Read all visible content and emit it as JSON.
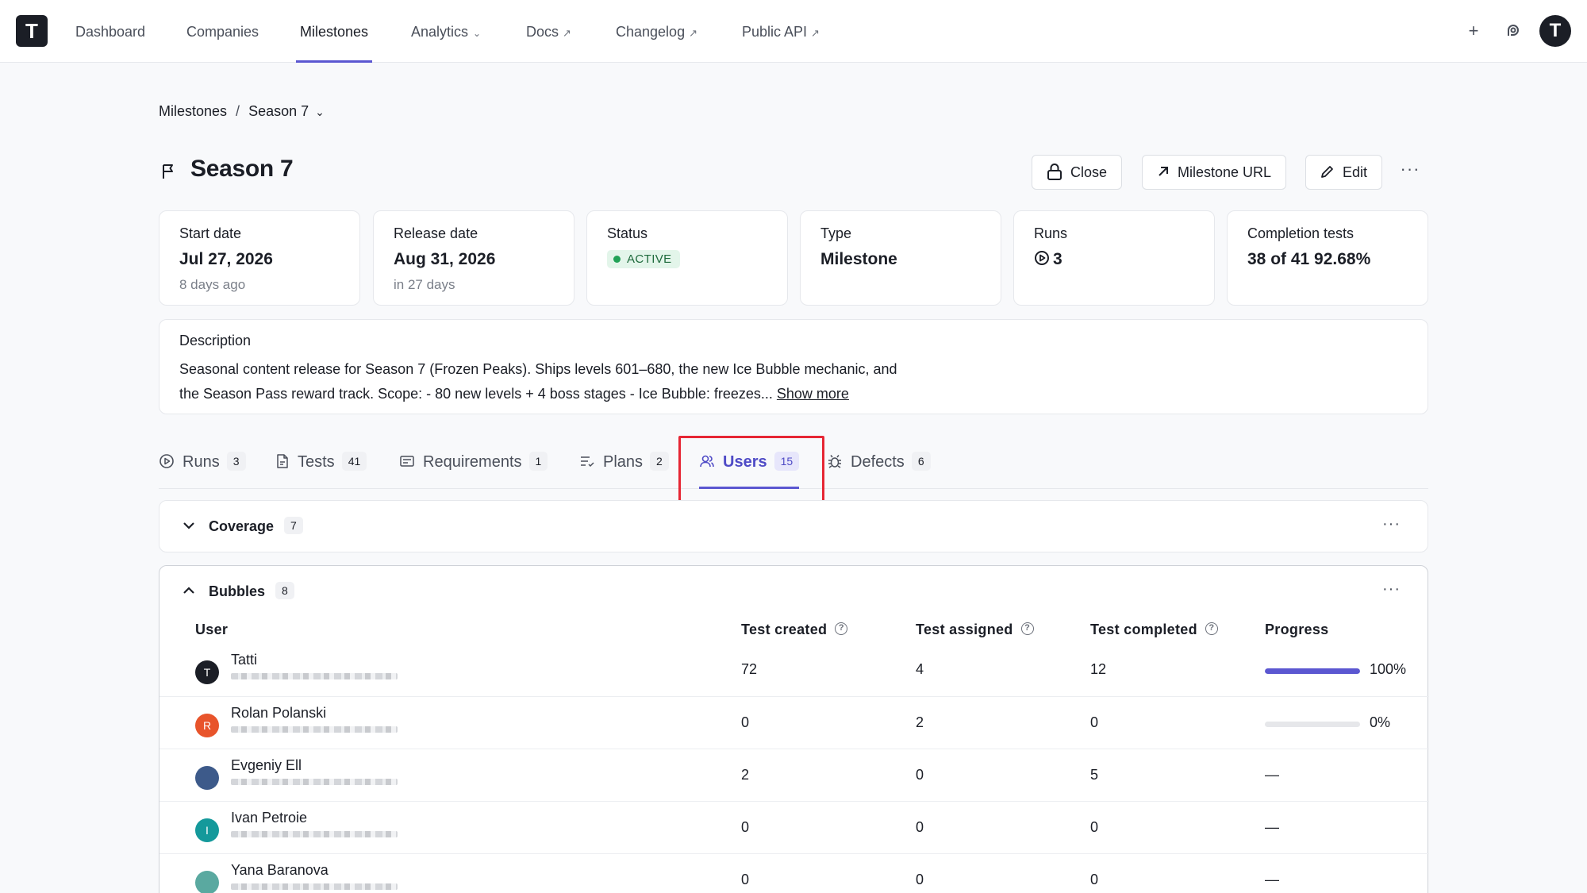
{
  "nav": {
    "logo": "T",
    "items": [
      {
        "label": "Dashboard"
      },
      {
        "label": "Companies"
      },
      {
        "label": "Milestones"
      },
      {
        "label": "Analytics"
      },
      {
        "label": "Docs"
      },
      {
        "label": "Changelog"
      },
      {
        "label": "Public API"
      }
    ],
    "active": "Milestones",
    "avatar": "T"
  },
  "breadcrumb": {
    "root": "Milestones",
    "separator": "/",
    "current": "Season 7"
  },
  "page": {
    "title": "Season 7"
  },
  "actions": {
    "close": "Close",
    "url": "Milestone URL",
    "edit": "Edit",
    "more": "···"
  },
  "stats": {
    "start": {
      "label": "Start date",
      "value": "Jul 27, 2026",
      "sub": "8 days ago"
    },
    "release": {
      "label": "Release date",
      "value": "Aug 31, 2026",
      "sub": "in 27 days"
    },
    "status": {
      "label": "Status",
      "value": "ACTIVE"
    },
    "type": {
      "label": "Type",
      "value": "Milestone"
    },
    "runs": {
      "label": "Runs",
      "value": "3"
    },
    "completion": {
      "label": "Completion tests",
      "value": "38 of 41 92.68%"
    }
  },
  "description": {
    "label": "Description",
    "line1": "Seasonal content release for Season 7 (Frozen Peaks). Ships levels 601–680, the new Ice Bubble mechanic, and",
    "line2": "the Season Pass reward track. Scope: - 80 new levels + 4 boss stages - Ice Bubble: freezes... ",
    "show_more": "Show more"
  },
  "tabs": [
    {
      "label": "Runs",
      "count": "3"
    },
    {
      "label": "Tests",
      "count": "41"
    },
    {
      "label": "Requirements",
      "count": "1"
    },
    {
      "label": "Plans",
      "count": "2"
    },
    {
      "label": "Users",
      "count": "15"
    },
    {
      "label": "Defects",
      "count": "6"
    }
  ],
  "groups": {
    "coverage": {
      "name": "Coverage",
      "count": "7",
      "more": "···"
    },
    "bubbles": {
      "name": "Bubbles",
      "count": "8",
      "more": "···",
      "columns": {
        "user": "User",
        "created": "Test created",
        "assigned": "Test assigned",
        "completed": "Test completed",
        "progress": "Progress"
      },
      "rows": [
        {
          "initial": "T",
          "avatar_color": "#1b1e26",
          "name": "Tatti",
          "created": "72",
          "assigned": "4",
          "completed": "12",
          "progress": 1.0,
          "progress_label": "100%"
        },
        {
          "initial": "R",
          "avatar_color": "#e8542b",
          "name": "Rolan Polanski",
          "created": "0",
          "assigned": "2",
          "completed": "0",
          "progress": 0.0,
          "progress_label": "0%"
        },
        {
          "initial": "",
          "avatar_color": "#3d5a8a",
          "name": "Evgeniy Ell",
          "created": "2",
          "assigned": "0",
          "completed": "5",
          "progress_label": "—"
        },
        {
          "initial": "I",
          "avatar_color": "#14999b",
          "name": "Ivan Petroie",
          "created": "0",
          "assigned": "0",
          "completed": "0",
          "progress_label": "—"
        },
        {
          "initial": "",
          "avatar_color": "#5aa9a0",
          "name": "Yana Baranova",
          "created": "0",
          "assigned": "0",
          "completed": "0",
          "progress_label": "—"
        }
      ]
    }
  }
}
